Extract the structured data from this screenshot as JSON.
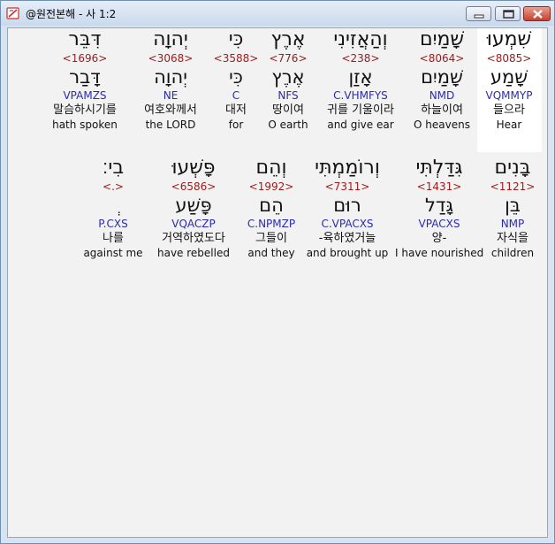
{
  "window": {
    "title": "@원전본해 - 사 1:2",
    "icon": "app-bible-icon",
    "controls": [
      "minimize-icon",
      "maximize-icon",
      "close-icon"
    ]
  },
  "verse": {
    "row1": [
      {
        "hebrew": "שִׁמְעוּ",
        "strong": "<8085>",
        "lemma": "שָׁמַע",
        "morph": "VQMMYP",
        "korean": "들으라",
        "english": "Hear",
        "selected": true
      },
      {
        "hebrew": "שָׁמַיִם",
        "strong": "<8064>",
        "lemma": "שָׁמַיִם",
        "morph": "NMD",
        "korean": "하늘이여",
        "english": "O heavens"
      },
      {
        "hebrew": "וְהַאֲזִינִי",
        "strong": "<238>",
        "lemma": "אָזַן",
        "morph": "C.VHMFYS",
        "korean": "귀를 기울이라",
        "english": "and give ear"
      },
      {
        "hebrew": "אֶרֶץ",
        "strong": "<776>",
        "lemma": "אֶרֶץ",
        "morph": "NFS",
        "korean": "땅이여",
        "english": "O earth"
      },
      {
        "hebrew": "כִּי",
        "strong": "<3588>",
        "lemma": "כִּי",
        "morph": "C",
        "korean": "대저",
        "english": "for"
      },
      {
        "hebrew": "יְהוָה",
        "strong": "<3068>",
        "lemma": "יְהוָה",
        "morph": "NE",
        "korean": "여호와께서",
        "english": "the LORD"
      },
      {
        "hebrew": "דִּבֵּר",
        "strong": "<1696>",
        "lemma": "דָּבַר",
        "morph": "VPAMZS",
        "korean": "말슴하시기를",
        "english": "hath spoken"
      }
    ],
    "row2": [
      {
        "hebrew": "בָּנִים",
        "strong": "<1121>",
        "lemma": "בֵּן",
        "morph": "NMP",
        "korean": "자식을",
        "english": "children"
      },
      {
        "hebrew": "גִּדַּלְתִּי",
        "strong": "<1431>",
        "lemma": "גָּדַל",
        "morph": "VPACXS",
        "korean": "양-",
        "english": "I have nourished"
      },
      {
        "hebrew": "וְרוֹמַמְתִּי",
        "strong": "<7311>",
        "lemma": "רוּם",
        "morph": "C.VPACXS",
        "korean": "-육하였거늘",
        "english": "and brought up"
      },
      {
        "hebrew": "וְהֵם",
        "strong": "<1992>",
        "lemma": "הֵם",
        "morph": "C.NPMZP",
        "korean": "그들이",
        "english": "and they"
      },
      {
        "hebrew": "פָּשְׁעוּ",
        "strong": "<6586>",
        "lemma": "פָּשַׁע",
        "morph": "VQACZP",
        "korean": "거역하였도다",
        "english": "have rebelled"
      },
      {
        "hebrew": "בִי׃",
        "strong": "<.>",
        "lemma": "ְ",
        "morph": "P.CXS",
        "korean": "나를",
        "english": "against me"
      }
    ]
  },
  "colors": {
    "strong": "#9a1b1b",
    "morph": "#2b2bb0",
    "selection": "#ffffff"
  }
}
